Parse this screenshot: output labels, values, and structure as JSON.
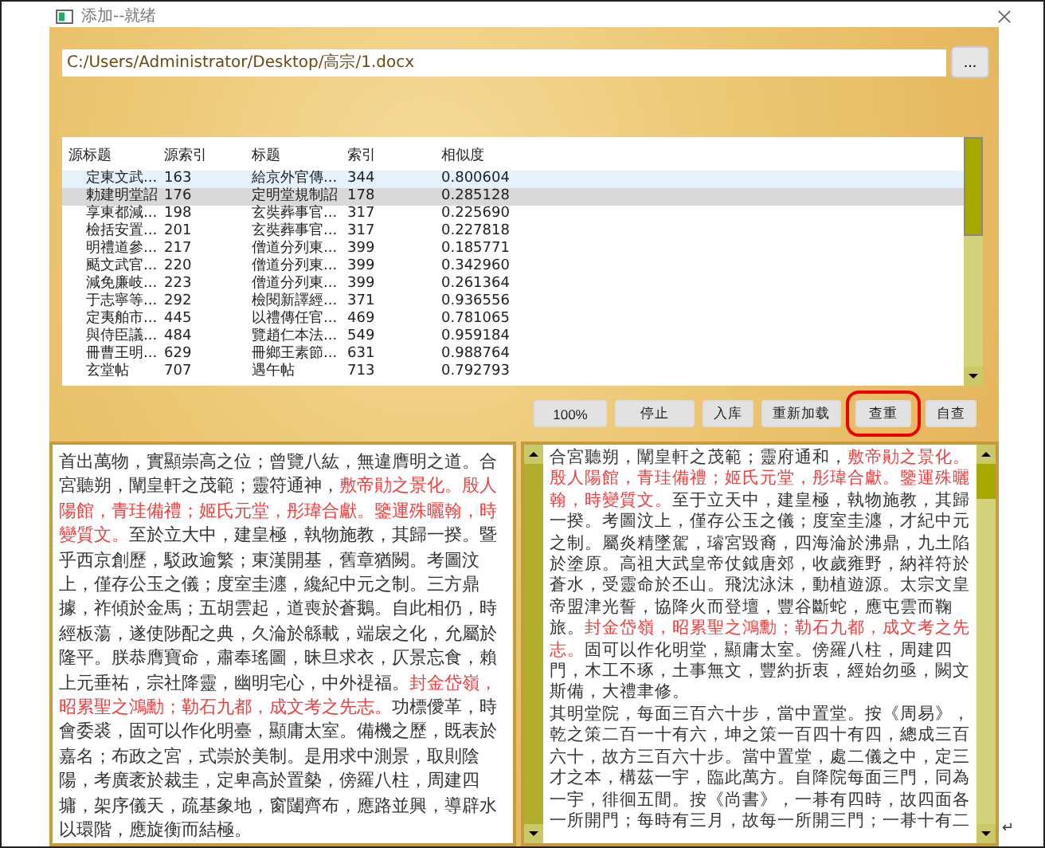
{
  "window": {
    "title": "添加--就绪"
  },
  "path_field": {
    "value": "C:/Users/Administrator/Desktop/高宗/1.docx"
  },
  "browse_button": {
    "label": "..."
  },
  "table": {
    "columns": [
      "源标题",
      "源索引",
      "标题",
      "索引",
      "相似度"
    ],
    "rows": [
      {
        "cells": [
          "定東文武...",
          "163",
          "給京外官傳...",
          "344",
          "0.800604"
        ],
        "selected": false,
        "hovered": true
      },
      {
        "cells": [
          "勅建明堂詔",
          "176",
          "定明堂規制詔",
          "178",
          "0.285128"
        ],
        "selected": true,
        "hovered": false
      },
      {
        "cells": [
          "享東都減...",
          "198",
          "玄奘葬事官...",
          "317",
          "0.225690"
        ],
        "selected": false,
        "hovered": false
      },
      {
        "cells": [
          "檢括安置...",
          "201",
          "玄奘葬事官...",
          "317",
          "0.227818"
        ],
        "selected": false,
        "hovered": false
      },
      {
        "cells": [
          "明禮道參...",
          "217",
          "僧道分列東...",
          "399",
          "0.185771"
        ],
        "selected": false,
        "hovered": false
      },
      {
        "cells": [
          "颳文武官...",
          "220",
          "僧道分列東...",
          "399",
          "0.342960"
        ],
        "selected": false,
        "hovered": false
      },
      {
        "cells": [
          "減免廉岐...",
          "223",
          "僧道分列東...",
          "399",
          "0.261364"
        ],
        "selected": false,
        "hovered": false
      },
      {
        "cells": [
          "于志寧等...",
          "292",
          "檢閱新譯經...",
          "371",
          "0.936556"
        ],
        "selected": false,
        "hovered": false
      },
      {
        "cells": [
          "定夷舶市...",
          "445",
          "以禮傳任官...",
          "469",
          "0.781065"
        ],
        "selected": false,
        "hovered": false
      },
      {
        "cells": [
          "與侍臣議...",
          "484",
          "覽趙仁本法...",
          "549",
          "0.959184"
        ],
        "selected": false,
        "hovered": false
      },
      {
        "cells": [
          "冊曹王明...",
          "629",
          "冊鄉王素節...",
          "631",
          "0.988764"
        ],
        "selected": false,
        "hovered": false
      },
      {
        "cells": [
          "玄堂帖",
          "707",
          "遇午帖",
          "713",
          "0.792793"
        ],
        "selected": false,
        "hovered": false
      }
    ]
  },
  "buttons": [
    {
      "label": "100%",
      "outlined": false
    },
    {
      "label": "停止",
      "outlined": false
    },
    {
      "label": "入库",
      "outlined": false
    },
    {
      "label": "重新加载",
      "outlined": false
    },
    {
      "label": "查重",
      "outlined": true
    },
    {
      "label": "自查",
      "outlined": false
    }
  ],
  "source_text": {
    "paragraphs": [
      [
        {
          "text": "首出萬物，實顯崇高之位；曾覽八紘，無違膺明之道。合宮聽朔，闡皇軒之茂範；靈符通神，",
          "highlight": false
        },
        {
          "text": "敷帝勛之景化。殷人陽館，青珪備禮；姬氏元堂，彤瑋合獻。鑒運殊曬翰，時變質文。",
          "highlight": true
        },
        {
          "text": "至於立大中，建皇極，執物施教，其歸一揆。暨乎西京創歷，駁政逾繁；東漢開基，舊章猶闕。考圖汶上，僅存公玉之儀；度室圭瀍，纔紀中元之制。三方鼎據，祚傾於金馬；五胡雲起，道喪於蒼鵝。自此相仍，時經板蕩，遂使陟配之典，久淪於緜載，端扆之化，允屬於隆平。朕恭膺寶命，肅奉瑤圖，昧旦求衣，仄景忘食，賴上元垂祐，宗社降靈，幽明宅心，中外禔福。",
          "highlight": false
        },
        {
          "text": "封金岱嶺，昭累聖之鴻勳；勒石九都，成文考之先志。",
          "highlight": true
        },
        {
          "text": "功標僾革，時會委裘，固可以作化明臺，顯庸太室。備機之歷，既表於嘉名；布政之宮，式崇於美制。是用求中測景，取則陰陽，考廣袤於裁圭，定卑高於置槷，傍羅八柱，周建四墉，架序儀天，疏基象地，窗闥齊布，應路並興，導辟水以環階，應旋衡而結極。",
          "highlight": false
        }
      ]
    ]
  },
  "target_text": {
    "paragraphs": [
      [
        {
          "text": "合宮聽朔，闡皇軒之茂範；靈府通和，",
          "highlight": false
        },
        {
          "text": "敷帝勛之景化。殷人陽館，青珪備禮；姬氏元堂，彤瑋合獻。鑒運殊曬翰，時變質文。",
          "highlight": true
        },
        {
          "text": "至于立天中，建皇極，執物施教，其歸一揆。考圖汶上，僅存公玉之儀；度室圭瀍，才紀中元之制。屬炎精墜駕，璿宮毀裔，四海淪於沸鼎，九土陷於塗原。高祖大武皇帝仗鉞唐郊，收歲雍野，納祥符於蒼水，受靈命於丕山。飛沈泳沫，動植遊源。太宗文皇帝盟津光誓，協降火而登壇，豐谷斷蛇，應屯雲而鞠旅。",
          "highlight": false
        },
        {
          "text": "封金岱嶺，昭累聖之鴻勳；勒石九都，成文考之先志。",
          "highlight": true
        },
        {
          "text": "固可以作化明堂，顯庸太室。傍羅八柱，周建四門，木工不琢，土事無文，豐約折衷，經始勿亟，闕文斯備，大禮聿修。",
          "highlight": false
        }
      ],
      [
        {
          "text": "其明堂院，每面三百六十步，當中置堂。按《周易》，乾之策二百一十有六，坤之策一百四十有四，總成三百六十，故方三百六十步。當中置堂，處二儀之中，定三才之本，構茲一宇，臨此萬方。自降院每面三門，同為一宇，徘徊五間。按《尚書》，一朞有四時，故四面各一所開門；每時有三月，故每一所開三門；一朞十有二",
          "highlight": false
        }
      ]
    ]
  },
  "trailing_mark": "↵"
}
